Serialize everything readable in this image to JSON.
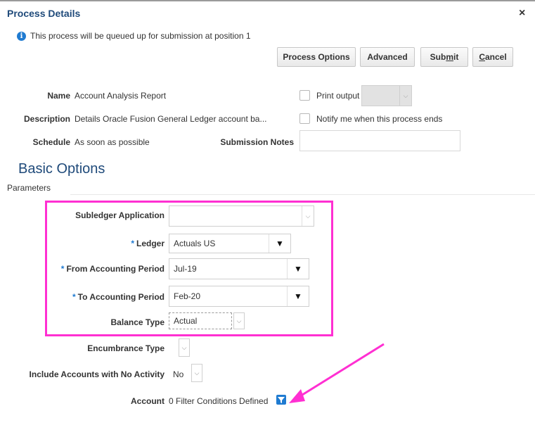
{
  "dialog": {
    "title": "Process Details",
    "close_symbol": "×"
  },
  "info": {
    "message": "This process will be queued up for submission at position 1"
  },
  "buttons": {
    "process_options": "Process Options",
    "advanced": "Advanced",
    "submit_pre": "Sub",
    "submit_mnemonic": "m",
    "submit_post": "it",
    "cancel_mnemonic": "C",
    "cancel_post": "ancel"
  },
  "details": {
    "name_label": "Name",
    "name_value": "Account Analysis Report",
    "description_label": "Description",
    "description_value": "Details Oracle Fusion General Ledger account ba...",
    "schedule_label": "Schedule",
    "schedule_value": "As soon as possible",
    "submission_notes_label": "Submission Notes",
    "print_output_label": "Print output",
    "notify_label": "Notify me when this process ends"
  },
  "basic_options": {
    "title": "Basic Options",
    "parameters_label": "Parameters",
    "fields": {
      "subledger_label": "Subledger Application",
      "subledger_value": "",
      "ledger_label": "Ledger",
      "ledger_value": "Actuals US",
      "from_period_label": "From Accounting Period",
      "from_period_value": "Jul-19",
      "to_period_label": "To Accounting Period",
      "to_period_value": "Feb-20",
      "balance_type_label": "Balance Type",
      "balance_type_value": "Actual",
      "encumbrance_label": "Encumbrance Type",
      "encumbrance_value": "",
      "include_accounts_label": "Include Accounts with No Activity",
      "include_accounts_value": "No",
      "account_label": "Account",
      "account_value": "0 Filter Conditions Defined"
    },
    "required_marker": "*"
  },
  "colors": {
    "highlight": "#ff2fd2",
    "title_blue": "#1f4a7a",
    "accent_blue": "#1f7bd1"
  }
}
